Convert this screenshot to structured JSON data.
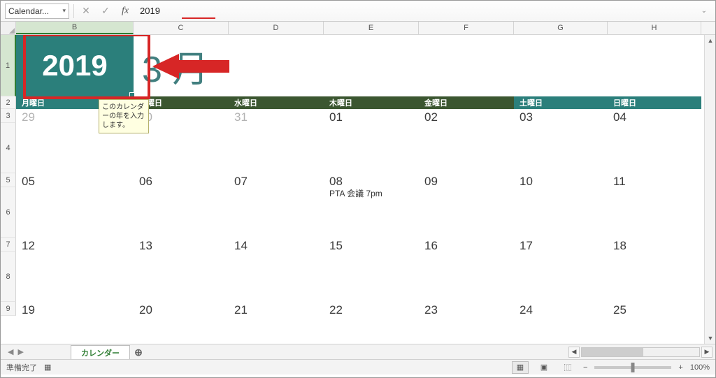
{
  "formula_bar": {
    "name_box": "Calendar...",
    "value": "2019"
  },
  "columns": [
    "B",
    "C",
    "D",
    "E",
    "F",
    "G",
    "H"
  ],
  "rows_visible": [
    "1",
    "2",
    "3",
    "4",
    "5",
    "6",
    "7",
    "8",
    "9"
  ],
  "year_cell": "2019",
  "month_label": "3 月",
  "tooltip_text": "このカレンダーの年を入力します。",
  "day_headers": [
    "月曜日",
    "火曜日",
    "水曜日",
    "木曜日",
    "金曜日",
    "土曜日",
    "日曜日"
  ],
  "weeks": [
    {
      "dates": [
        "29",
        "30",
        "31",
        "01",
        "02",
        "03",
        "04"
      ],
      "dimmed": [
        true,
        true,
        true,
        false,
        false,
        false,
        false
      ],
      "notes": [
        "",
        "",
        "",
        "",
        "",
        "",
        ""
      ]
    },
    {
      "dates": [
        "05",
        "06",
        "07",
        "08",
        "09",
        "10",
        "11"
      ],
      "dimmed": [
        false,
        false,
        false,
        false,
        false,
        false,
        false
      ],
      "notes": [
        "",
        "",
        "",
        "PTA 会議 7pm",
        "",
        "",
        ""
      ]
    },
    {
      "dates": [
        "12",
        "13",
        "14",
        "15",
        "16",
        "17",
        "18"
      ],
      "dimmed": [
        false,
        false,
        false,
        false,
        false,
        false,
        false
      ],
      "notes": [
        "",
        "",
        "",
        "",
        "",
        "",
        ""
      ]
    },
    {
      "dates": [
        "19",
        "20",
        "21",
        "22",
        "23",
        "24",
        "25"
      ],
      "dimmed": [
        false,
        false,
        false,
        false,
        false,
        false,
        false
      ],
      "notes": [
        "",
        "",
        "",
        "",
        "",
        "",
        ""
      ]
    }
  ],
  "sheet_tab": "カレンダー",
  "status": {
    "ready": "準備完了",
    "zoom": "100%"
  }
}
